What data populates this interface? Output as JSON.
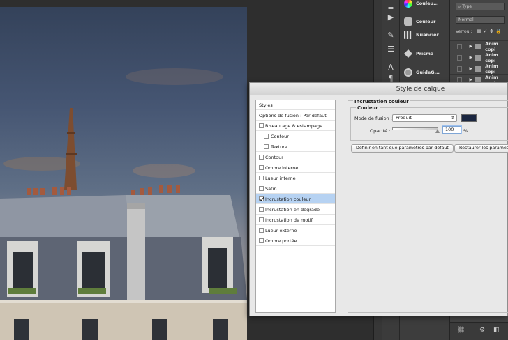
{
  "dialog": {
    "title": "Style de calque",
    "styles_list": [
      {
        "label": "Styles",
        "type": "header"
      },
      {
        "label": "Options de fusion : Par défaut",
        "type": "plain"
      },
      {
        "label": "Biseautage & estampage",
        "type": "check",
        "checked": false
      },
      {
        "label": "Contour",
        "type": "sub",
        "checked": false
      },
      {
        "label": "Texture",
        "type": "sub",
        "checked": false
      },
      {
        "label": "Contour",
        "type": "check",
        "checked": false
      },
      {
        "label": "Ombre interne",
        "type": "check",
        "checked": false
      },
      {
        "label": "Lueur interne",
        "type": "check",
        "checked": false
      },
      {
        "label": "Satin",
        "type": "check",
        "checked": false
      },
      {
        "label": "Incrustation couleur",
        "type": "check",
        "checked": true,
        "selected": true
      },
      {
        "label": "Incrustation en dégradé",
        "type": "check",
        "checked": false
      },
      {
        "label": "Incrustation de motif",
        "type": "check",
        "checked": false
      },
      {
        "label": "Lueur externe",
        "type": "check",
        "checked": false
      },
      {
        "label": "Ombre portée",
        "type": "check",
        "checked": false
      }
    ],
    "section_title": "Incrustation couleur",
    "group_title": "Couleur",
    "blend_label": "Mode de fusion :",
    "blend_value": "Produit",
    "overlay_color": "#1a2640",
    "opacity_label": "Opacité :",
    "opacity_value": "100",
    "opacity_unit": "%",
    "btn_default": "Définir en tant que paramètres par défaut",
    "btn_restore": "Restaurer les paramètres"
  },
  "panels": [
    {
      "label": "Couleu...",
      "icon": "color-wheel-icon"
    },
    {
      "label": "Couleur",
      "icon": "palette-icon"
    },
    {
      "label": "Nuancier",
      "icon": "swatches-icon"
    },
    {
      "label": "Prisma",
      "icon": "prisma-icon"
    },
    {
      "label": "GuideG...",
      "icon": "guide-icon"
    }
  ],
  "layers": {
    "filter_placeholder": "Type",
    "blend_mode": "Normal",
    "lock_label": "Verrou :",
    "rows": [
      {
        "name": "Anim copi"
      },
      {
        "name": "Anim copi"
      },
      {
        "name": "Anim copi"
      },
      {
        "name": "Anim copi"
      }
    ]
  }
}
